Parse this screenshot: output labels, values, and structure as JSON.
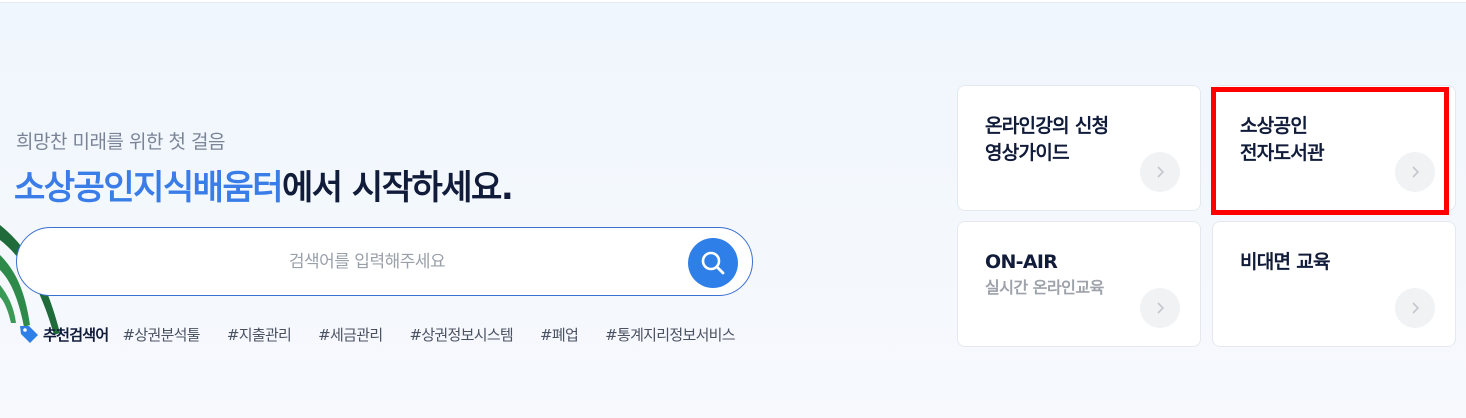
{
  "hero": {
    "subtitle": "희망찬 미래를 위한 첫 걸음",
    "headline_brand": "소상공인지식배움터",
    "headline_rest": "에서 시작하세요."
  },
  "search": {
    "placeholder": "검색어를 입력해주세요",
    "value": "",
    "button_icon": "search-icon"
  },
  "keywords": {
    "title": "추천검색어",
    "icon": "tag-icon",
    "items": [
      "#상권분석툴",
      "#지출관리",
      "#세금관리",
      "#상권정보시스템",
      "#폐업",
      "#통계지리정보서비스"
    ]
  },
  "cards": [
    {
      "title_line1": "온라인강의 신청",
      "title_line2": "영상가이드",
      "sub": "",
      "icon": "chevron-right-icon"
    },
    {
      "title_line1": "소상공인",
      "title_line2": "전자도서관",
      "sub": "",
      "icon": "chevron-right-icon",
      "highlighted": true
    },
    {
      "title_line1": "ON-AIR",
      "title_line2": "",
      "sub": "실시간 온라인교육",
      "icon": "chevron-right-icon"
    },
    {
      "title_line1": "비대면 교육",
      "title_line2": "",
      "sub": "",
      "icon": "chevron-right-icon"
    }
  ],
  "colors": {
    "brand_blue": "#3a7de8",
    "dark_text": "#111b3a",
    "highlight_red": "#ff0000",
    "search_button": "#2f7fe8"
  }
}
